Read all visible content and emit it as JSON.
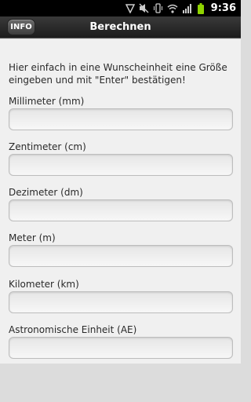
{
  "status_bar": {
    "time": "9:36",
    "icons": [
      "mute-icon",
      "vibrate-icon",
      "wifi-icon",
      "signal-icon",
      "battery-icon",
      "notification-icon"
    ]
  },
  "action_bar": {
    "info_label": "INFO",
    "title": "Berechnen"
  },
  "intro_text": "Hier einfach in eine Wunscheinheit eine Größe eingeben und mit \"Enter\" bestätigen!",
  "fields": [
    {
      "label": "Millimeter (mm)",
      "value": ""
    },
    {
      "label": "Zentimeter (cm)",
      "value": ""
    },
    {
      "label": "Dezimeter (dm)",
      "value": ""
    },
    {
      "label": "Meter (m)",
      "value": ""
    },
    {
      "label": "Kilometer (km)",
      "value": ""
    },
    {
      "label": "Astronomische Einheit (AE)",
      "value": ""
    }
  ],
  "colors": {
    "status_bar": "#000000",
    "action_bar": "#2a2a2a",
    "content_bg": "#f0f0f0",
    "battery": "#8fd400"
  }
}
